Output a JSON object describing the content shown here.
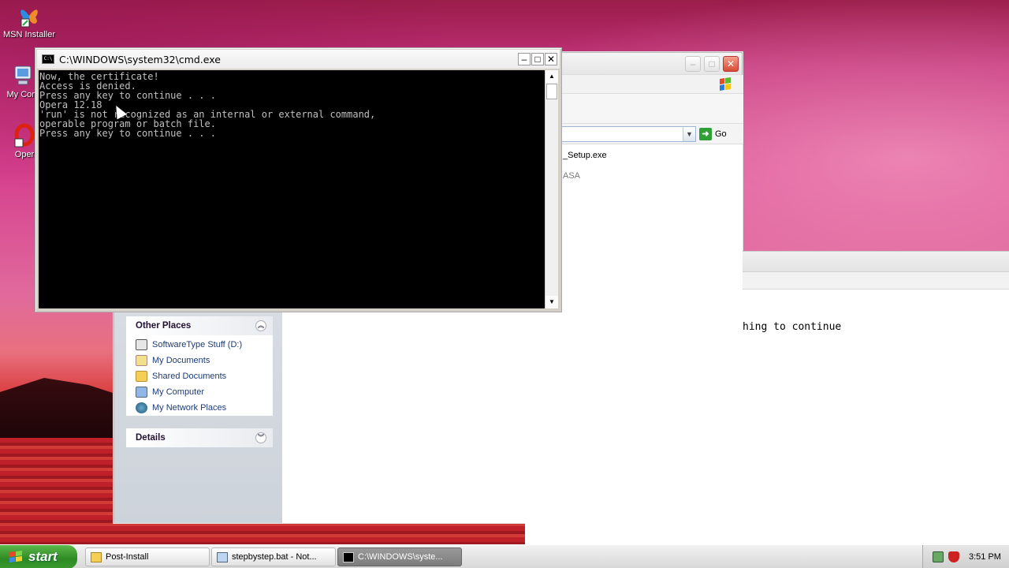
{
  "desktop": {
    "icons": [
      {
        "label": "MSN Installer",
        "icon": "msn-butterfly-icon"
      },
      {
        "label": "My Com",
        "icon": "my-computer-icon"
      },
      {
        "label": "Oper",
        "icon": "opera-icon"
      }
    ]
  },
  "cmd_window": {
    "title": "C:\\WINDOWS\\system32\\cmd.exe",
    "lines": [
      "Now, the certificate!",
      "Access is denied.",
      "Press any key to continue . . .",
      "Opera 12.18",
      "'run' is not recognized as an internal or external command,",
      "operable program or batch file.",
      "Press any key to continue . . ."
    ],
    "colors": {
      "background": "#000000",
      "text": "#c0c0c0"
    }
  },
  "explorer_window": {
    "go_label": "Go",
    "files": [
      {
        "name": "_Setup.exe"
      },
      {
        "name": "ASA"
      }
    ],
    "other_places": {
      "title": "Other Places",
      "items": [
        {
          "label": "SoftwareType Stuff (D:)",
          "icon": "drive-icon"
        },
        {
          "label": "My Documents",
          "icon": "my-documents-icon"
        },
        {
          "label": "Shared Documents",
          "icon": "folder-icon"
        },
        {
          "label": "My Computer",
          "icon": "my-computer-icon"
        },
        {
          "label": "My Network Places",
          "icon": "network-places-icon"
        }
      ]
    },
    "details": {
      "title": "Details"
    }
  },
  "background_window": {
    "text": "hing to continue"
  },
  "taskbar": {
    "start_label": "start",
    "tasks": [
      {
        "label": "Post-Install",
        "icon": "folder-icon",
        "active": false
      },
      {
        "label": "stepbystep.bat - Not...",
        "icon": "notepad-icon",
        "active": false
      },
      {
        "label": "C:\\WINDOWS\\syste...",
        "icon": "cmd-icon",
        "active": true
      }
    ],
    "clock": "3:51 PM"
  }
}
